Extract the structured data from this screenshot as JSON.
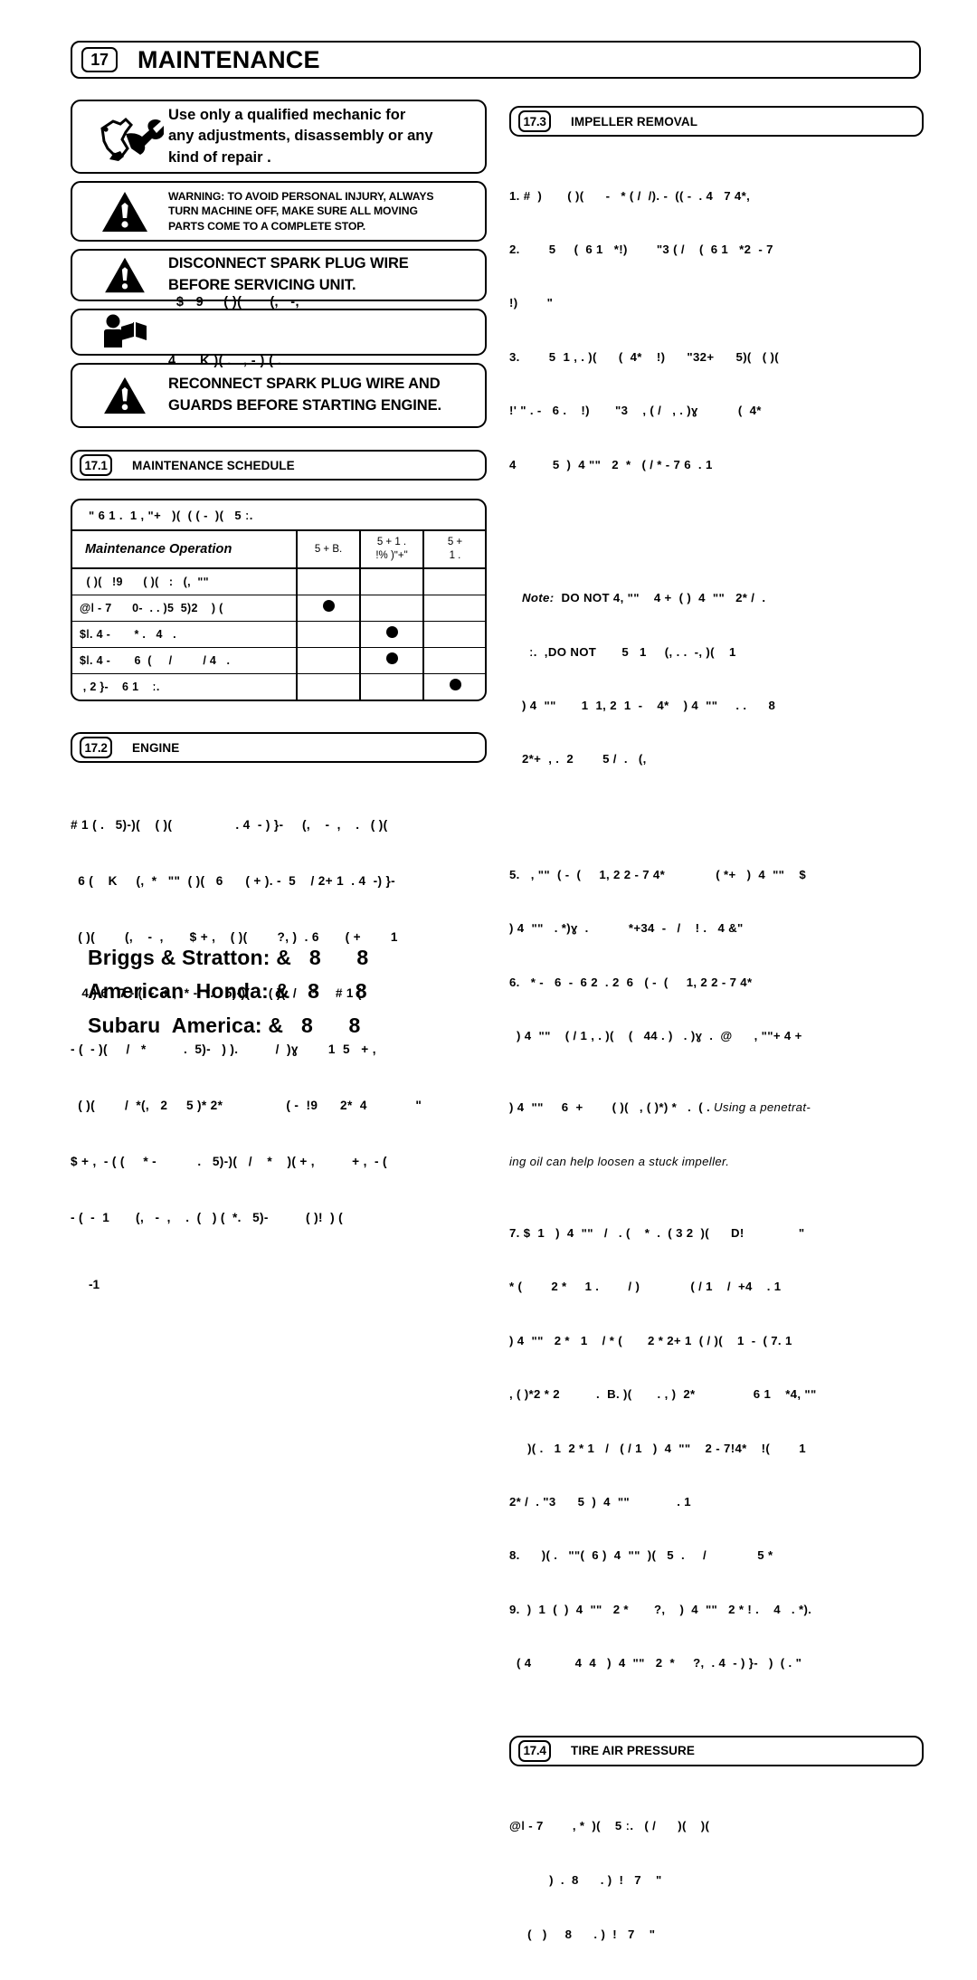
{
  "chapter": {
    "number": "17",
    "title": "MAINTENANCE"
  },
  "left_column": {
    "notice_mechanic": {
      "icon": "mechanic-wrench-icon",
      "text_line1": "Use only a qualified mechanic for",
      "text_line2": "any adjustments, disassembly or any",
      "text_line3": "kind of repair ."
    },
    "notice_warning": {
      "icon": "warning-triangle-icon",
      "text_line1": "WARNING:  TO AVOID PERSONAL INJURY, ALWAYS",
      "text_line2": "TURN MACHINE OFF, MAKE SURE ALL MOVING",
      "text_line3": "PARTS COME TO A COMPLETE STOP."
    },
    "notice_disconnect": {
      "icon": "warning-triangle-icon",
      "text_line1": "DISCONNECT SPARK PLUG WIRE",
      "text_line2": "BEFORE SERVICING UNIT."
    },
    "notice_read_manual": {
      "icon": "read-manual-icon",
      "text_line1": "  $   9     ( )(       (,   -,",
      "text_line2": "4      K )( .   , - ) ( ."
    },
    "notice_reconnect": {
      "icon": "warning-triangle-icon",
      "text_line1": "RECONNECT  SPARK PLUG WIRE AND",
      "text_line2": "GUARDS BEFORE STARTING ENGINE."
    },
    "section_schedule": {
      "number": "17.1",
      "title": "MAINTENANCE SCHEDULE",
      "table_caption": "ʺ 6 1 .  1 , ʺ+   )(  ( ( -  )(   5 ː.",
      "columns": [
        "Maintenance Operation",
        "5   + B.",
        "5  +  1 .\n!% )ʺ+\"",
        "5   +\n1 ."
      ],
      "rows": [
        {
          "operation": "  ( )(   !9      ( )(   :   (,  ʺʺ",
          "marks": [
            false,
            false,
            false
          ]
        },
        {
          "operation": "@ǀ - 7      0-  . . )5  5)2    ) (",
          "marks": [
            true,
            false,
            false
          ]
        },
        {
          "operation": "$ǀ. 4 -       * .   4   .",
          "marks": [
            false,
            true,
            false
          ]
        },
        {
          "operation": "$ǀ. 4 -       6  (     /         / 4   .",
          "marks": [
            false,
            true,
            false
          ]
        },
        {
          "operation": " , 2 }‐    6 1    ː.",
          "marks": [
            false,
            false,
            true
          ]
        }
      ]
    },
    "section_engine": {
      "number": "17.2",
      "title": "ENGINE",
      "paragraph_lines": [
        "# 1 ( .   5)‐)(    ( )(                 . 4  - ) }‐     (,    -  ,    .   ( )(",
        "  6 (    K     (,  *   ʺʺ  ( )(   6      ( + ). -  5    / 2+ 1  . 4  -) }‐",
        "  ( )(        (,    -  ,       $ + ,    ( )(        ?, )  . 6       ( +        1",
        "   4 ) 6   7 - (  -  + ,  * -  *.   5)‐)(     ( )(  /    *     # 1 (",
        "- (  - )(     /   *          .  5)‐   ) ).          /  )ɣ        1  5   + ,",
        "  ( )(        /  *(,   2     5 )* 2*                 ( -  !9      2*  4             \"",
        "$ + ,  - ( (     * -           .   5)‐)(   /    *    )( + ,          + ,  - (",
        "- (  -  1       (,   -  ,    .  (   ) (  *.   5)‐          ( )ǃ  ) ("
      ],
      "trailing_line": "-1"
    },
    "brands": [
      "Briggs & Stratton: &   8      8",
      "American  Honda: &   8      8",
      "Subaru  America: &   8      8"
    ]
  },
  "right_column": {
    "section_impeller": {
      "number": "17.3",
      "title": "IMPELLER REMOVAL",
      "lines": [
        "1. #  )       ( )(      -   * ( /  /). -  (( -  . 4   7 4*,",
        "2.        5     (  6 1   *!)        \"3 ( /    (  6 1   *2  - 7",
        "!)        \"",
        "3.        5  1 , . )(      (  4*    !)      \"32+      5)(   ( )(",
        "!' \" . -   6 .    !)       \"3    , ( /   , . )ɣ           (  4*",
        "4          5  )  4 ʺʺ   2  *   ( / * - 7 6  . 1"
      ],
      "note": {
        "lead": "Note:",
        "line1_bold": "DO NOT",
        "line1_rest": " 4, ʺʺ    4 +  ( )  4  ʺʺ   2* /  .",
        "line2_pre": "  ː.  ,",
        "line2_bold": "DO NOT",
        "line2_rest": "       5   1     (, . .  -, )(    1",
        "line3": ") 4  ʺʺ       1  1, 2  1  -    4*    ) 4  ʺʺ     . .      8",
        "line4": "2*+  , .  2        5 /  .   (,"
      },
      "lines2": [
        "5.   , ʺʺ  ( -  (     1, 2 2 - 7 4*              ( *+   )  4  ʺʺ    $",
        ") 4  ʺʺ   . *)ɣ  .           *+34  -   /    ! .   4 &\"",
        "6.   * -   6  -  6 2  . 2  6   ( -  (     1, 2 2 - 7 4*",
        "  ) 4  ʺʺ    ( / 1 , . )(    (   44 . )   . )ɣ  .  @      , ʺʺ+ 4 +"
      ],
      "penetrating_prefix": ") 4  ʺʺ     6  +        ( )(   , ( )*) *   .  ( . ",
      "penetrating_italic": "Using a penetrat-",
      "penetrating_italic2": "ing oil can help loosen a stuck impeller.",
      "lines3": [
        "7. $  1   )  4  ʺʺ   /   . (    *  .  ( 3 2  )(      D!               \"",
        "* (        2 *     1 .        / )              ( / 1    /  +4    . 1",
        ") 4  ʺʺ   2 *   1    / * (       2 * 2+ 1  ( / )(    1  -  ( 7. 1",
        ", ( )*2 * 2          .  B. )(       . , )  2*                6 1    *4, ʺʺ",
        "     )( .   1  2 * 1   /   ( / 1   )  4  ʺʺ    2 - 7ǃ4*    !(        1",
        "2* /  . \"3      5  )  4  ʺʺ             . 1",
        "8.      )( .   ʺʺ(  6 )  4  ʺʺ  )(   5  .     /              5 *",
        "9.  )  1  (  )  4  ʺʺ   2 *       ?,    )  4  ʺʺ   2 * ! .    4   . *).",
        "  ( 4            4  4   )  4  ʺʺ   2  *     ?,  . 4  - ) }‐   )  ( . \""
      ]
    },
    "section_tire": {
      "number": "17.4",
      "title": "TIRE AIR PRESSURE",
      "lines": [
        "@ǀ - 7        , *  )(    5 ː.   ( /      )(    )(",
        "           )  .  8      . )  !   7    \"",
        "     (   )     8      . )  !   7    \""
      ]
    }
  }
}
